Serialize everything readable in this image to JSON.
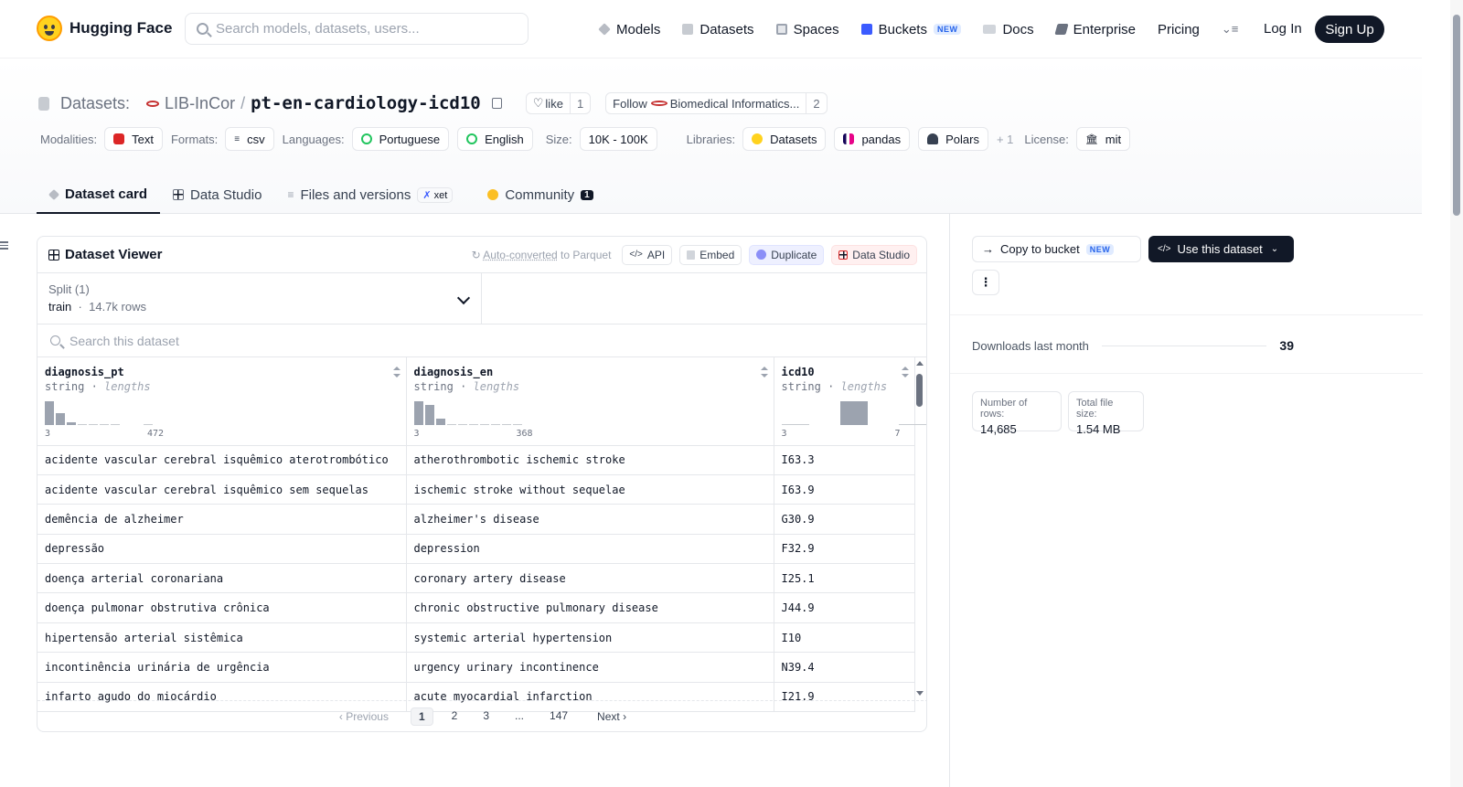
{
  "brand": {
    "name": "Hugging Face"
  },
  "search": {
    "placeholder": "Search models, datasets, users..."
  },
  "nav": {
    "items": [
      {
        "label": "Models",
        "color": "#9ca3af"
      },
      {
        "label": "Datasets",
        "color": "#c7cbd1"
      },
      {
        "label": "Spaces",
        "color": "#9ca3af"
      },
      {
        "label": "Buckets",
        "color": "#3b5bff",
        "badge": "NEW"
      },
      {
        "label": "Docs",
        "color": "#9ca3af"
      },
      {
        "label": "Enterprise",
        "color": "#6b7280"
      },
      {
        "label": "Pricing"
      }
    ],
    "login": "Log In",
    "signup": "Sign Up"
  },
  "repo": {
    "crumb_prefix": "Datasets:",
    "org": "LIB-InCor",
    "name": "pt-en-cardiology-icd10",
    "like_label": "like",
    "like_count": "1",
    "follow_label": "Follow",
    "follow_org": "Biomedical Informatics...",
    "follow_count": "2"
  },
  "tags": {
    "modalities_label": "Modalities:",
    "modality": "Text",
    "formats_label": "Formats:",
    "format": "csv",
    "languages_label": "Languages:",
    "languages": [
      "Portuguese",
      "English"
    ],
    "size_label": "Size:",
    "size": "10K - 100K",
    "libraries_label": "Libraries:",
    "libraries": [
      "Datasets",
      "pandas",
      "Polars"
    ],
    "libraries_more": "+ 1",
    "license_label": "License:",
    "license": "mit"
  },
  "tabs": {
    "card": "Dataset card",
    "studio": "Data Studio",
    "files": "Files and versions",
    "xet": "xet",
    "community": "Community",
    "community_count": "1"
  },
  "viewer": {
    "title": "Dataset Viewer",
    "auto_converted": "Auto-converted",
    "to_parquet": "to Parquet",
    "api": "API",
    "embed": "Embed",
    "duplicate": "Duplicate",
    "data_studio": "Data Studio",
    "split_label": "Split (1)",
    "split_value": "train",
    "split_rows": "14.7k rows",
    "search_placeholder": "Search this dataset",
    "columns": [
      {
        "name": "diagnosis_pt",
        "type": "string",
        "stat": "lengths",
        "min": "3",
        "max": "472",
        "bins": [
          24,
          12,
          3,
          1,
          1,
          1,
          1,
          0,
          0,
          1
        ]
      },
      {
        "name": "diagnosis_en",
        "type": "string",
        "stat": "lengths",
        "min": "3",
        "max": "368",
        "bins": [
          24,
          20,
          6,
          1,
          1,
          1,
          1,
          1,
          1,
          1
        ]
      },
      {
        "name": "icd10",
        "type": "string",
        "stat": "lengths",
        "min": "3",
        "max": "7",
        "bins": [
          1,
          0,
          24,
          0,
          1
        ]
      }
    ],
    "rows": [
      [
        "acidente vascular cerebral isquêmico aterotrombótico",
        "atherothrombotic ischemic stroke",
        "I63.3"
      ],
      [
        "acidente vascular cerebral isquêmico sem sequelas",
        "ischemic stroke without sequelae",
        "I63.9"
      ],
      [
        "demência de alzheimer",
        "alzheimer's disease",
        "G30.9"
      ],
      [
        "depressão",
        "depression",
        "F32.9"
      ],
      [
        "doença arterial coronariana",
        "coronary artery disease",
        "I25.1"
      ],
      [
        "doença pulmonar obstrutiva crônica",
        "chronic obstructive pulmonary disease",
        "J44.9"
      ],
      [
        "hipertensão arterial sistêmica",
        "systemic arterial hypertension",
        "I10"
      ],
      [
        "incontinência urinária de urgência",
        "urgency urinary incontinence",
        "N39.4"
      ],
      [
        "infarto agudo do miocárdio",
        "acute myocardial infarction",
        "I21.9"
      ]
    ],
    "pager": {
      "prev": "Previous",
      "pages": [
        "1",
        "2",
        "3",
        "...",
        "147"
      ],
      "next": "Next",
      "current": "1"
    }
  },
  "sidebar": {
    "copy_to_bucket": "Copy to bucket",
    "copy_badge": "NEW",
    "use_dataset": "Use this dataset",
    "more": "⋮",
    "downloads_label": "Downloads last month",
    "downloads_value": "39",
    "rows_label": "Number of rows:",
    "rows_value": "14,685",
    "size_label": "Total file size:",
    "size_value": "1.54 MB"
  }
}
